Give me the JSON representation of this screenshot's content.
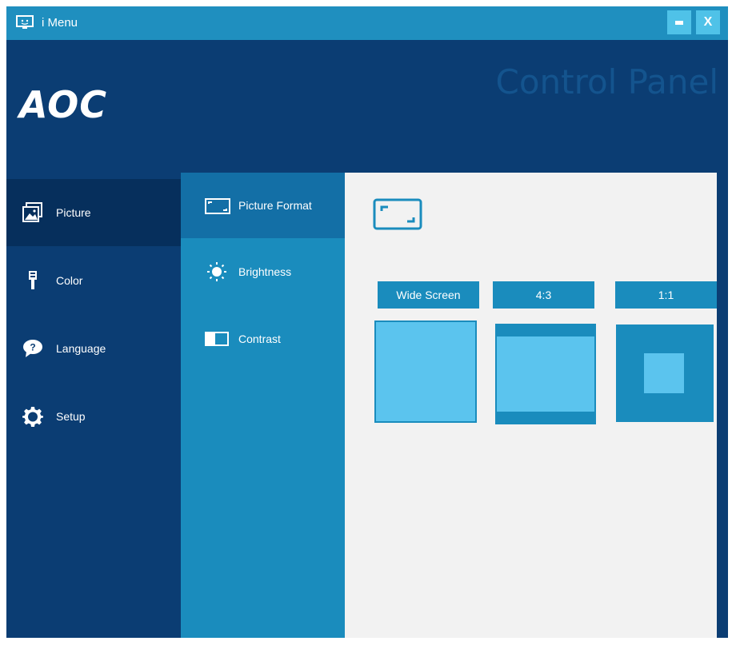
{
  "window": {
    "title": "i Menu",
    "minimize_label": "",
    "close_label": "X"
  },
  "header": {
    "logo": "AOC",
    "title": "Control Panel"
  },
  "nav": {
    "items": [
      {
        "label": "Picture",
        "icon": "picture-icon",
        "active": true
      },
      {
        "label": "Color",
        "icon": "color-icon",
        "active": false
      },
      {
        "label": "Language",
        "icon": "language-icon",
        "active": false
      },
      {
        "label": "Setup",
        "icon": "gear-icon",
        "active": false
      }
    ]
  },
  "subnav": {
    "items": [
      {
        "label": "Picture Format",
        "icon": "picture-format-icon",
        "active": true
      },
      {
        "label": "Brightness",
        "icon": "brightness-icon",
        "active": false
      },
      {
        "label": "Contrast",
        "icon": "contrast-icon",
        "active": false
      }
    ]
  },
  "content": {
    "options": [
      {
        "label": "Wide Screen"
      },
      {
        "label": "4:3"
      },
      {
        "label": "1:1"
      }
    ]
  },
  "colors": {
    "dark_blue": "#0b3d73",
    "active_nav": "#062f5c",
    "mid_blue": "#1a8cbd",
    "title_bar": "#1f8fbf",
    "light_blue": "#5bc4ee",
    "content_bg": "#f2f2f2"
  }
}
